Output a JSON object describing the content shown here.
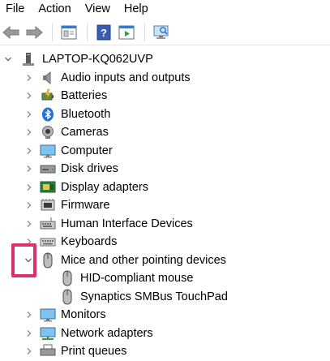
{
  "menu": {
    "file": "File",
    "action": "Action",
    "view": "View",
    "help": "Help"
  },
  "toolbar": {
    "buttons": [
      "back-arrow-icon",
      "forward-arrow-icon",
      "properties-icon",
      "help-icon",
      "run-icon",
      "scan-hardware-icon"
    ]
  },
  "tree": {
    "root": "LAPTOP-KQ062UVP",
    "categories": {
      "audio": "Audio inputs and outputs",
      "batteries": "Batteries",
      "bluetooth": "Bluetooth",
      "cameras": "Cameras",
      "computer": "Computer",
      "disk": "Disk drives",
      "display": "Display adapters",
      "firmware": "Firmware",
      "hid": "Human Interface Devices",
      "keyboards": "Keyboards",
      "mice": "Mice and other pointing devices",
      "monitors": "Monitors",
      "network": "Network adapters",
      "print": "Print queues"
    },
    "mice_children": {
      "hid_mouse": "HID-compliant mouse",
      "touchpad": "Synaptics SMBus TouchPad"
    }
  },
  "colors": {
    "highlight": "#e0306a",
    "accent": "#1e73d8"
  }
}
